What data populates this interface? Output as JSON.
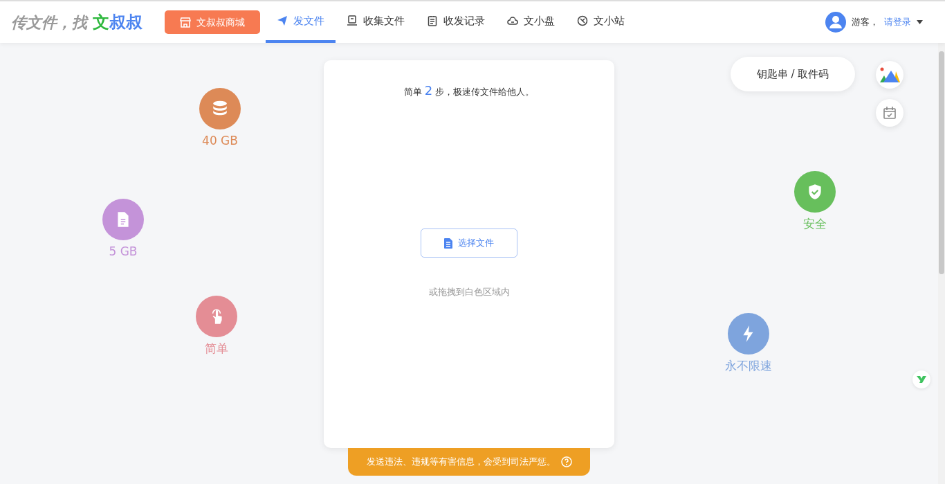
{
  "header": {
    "logo_prefix": "传文件，找",
    "logo_green": "文",
    "logo_blue": "叔叔",
    "shop_button": "文叔叔商城",
    "nav": [
      {
        "label": "发文件",
        "selected": true
      },
      {
        "label": "收集文件",
        "selected": false
      },
      {
        "label": "收发记录",
        "selected": false
      },
      {
        "label": "文小盘",
        "selected": false
      },
      {
        "label": "文小站",
        "selected": false
      }
    ],
    "user": {
      "guest": "游客，",
      "login": "请登录"
    }
  },
  "features": [
    {
      "label": "40 GB",
      "color": "#dd8a57"
    },
    {
      "label": "5 GB",
      "color": "#c493d9"
    },
    {
      "label": "简单",
      "color": "#e48d95"
    },
    {
      "label": "安全",
      "color": "#67bf5c"
    },
    {
      "label": "永不限速",
      "color": "#7ea4dd"
    }
  ],
  "upload": {
    "prefix": "简单",
    "step": "2",
    "suffix": "步，极速传文件给他人。",
    "button": "选择文件",
    "hint": "或拖拽到白色区域内"
  },
  "key_button": "钥匙串 / 取件码",
  "notice": "发送违法、违规等有害信息，会受到司法严惩。"
}
